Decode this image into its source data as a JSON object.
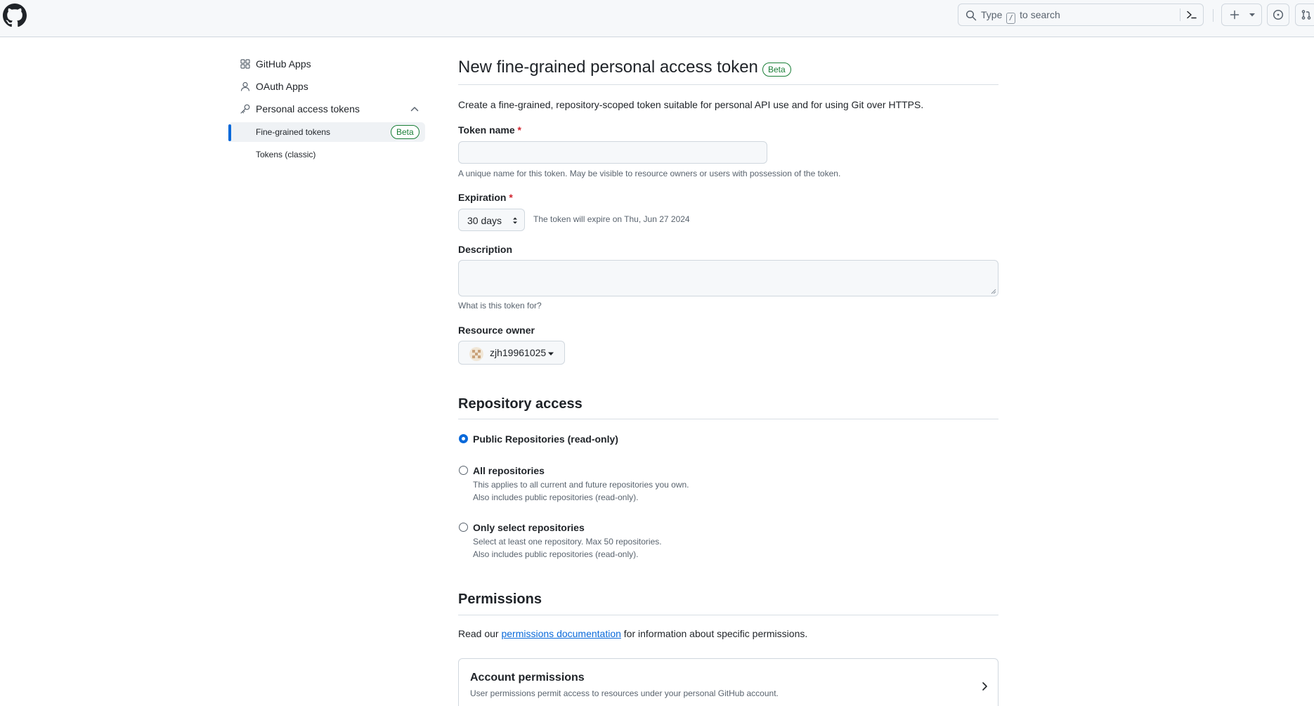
{
  "search": {
    "prefix": "Type",
    "key": "/",
    "suffix": "to search"
  },
  "sidebar": {
    "items": [
      {
        "label": "GitHub Apps"
      },
      {
        "label": "OAuth Apps"
      },
      {
        "label": "Personal access tokens"
      }
    ],
    "sub_items": [
      {
        "label": "Fine-grained tokens",
        "badge": "Beta",
        "active": true
      },
      {
        "label": "Tokens (classic)"
      }
    ]
  },
  "main": {
    "title": "New fine-grained personal access token",
    "title_badge": "Beta",
    "lead": "Create a fine-grained, repository-scoped token suitable for personal API use and for using Git over HTTPS.",
    "token_name": {
      "label": "Token name",
      "required_mark": "*",
      "value": "",
      "note": "A unique name for this token. May be visible to resource owners or users with possession of the token."
    },
    "expiration": {
      "label": "Expiration",
      "required_mark": "*",
      "value": "30 days",
      "note": "The token will expire on Thu, Jun 27 2024"
    },
    "description": {
      "label": "Description",
      "value": "",
      "note": "What is this token for?"
    },
    "resource_owner": {
      "label": "Resource owner",
      "value": "zjh19961025"
    },
    "repository_access": {
      "heading": "Repository access",
      "options": [
        {
          "label": "Public Repositories (read-only)",
          "checked": true,
          "desc": []
        },
        {
          "label": "All repositories",
          "checked": false,
          "desc": [
            "This applies to all current and future repositories you own.",
            "Also includes public repositories (read-only)."
          ]
        },
        {
          "label": "Only select repositories",
          "checked": false,
          "desc": [
            "Select at least one repository. Max 50 repositories.",
            "Also includes public repositories (read-only)."
          ]
        }
      ]
    },
    "permissions": {
      "heading": "Permissions",
      "text_before": "Read our",
      "link": "permissions documentation",
      "text_after": "for information about specific permissions.",
      "account": {
        "title": "Account permissions",
        "desc": "User permissions permit access to resources under your personal GitHub account."
      }
    }
  },
  "colors": {
    "accent": "#0969da",
    "success": "#1a7f37",
    "danger": "#d1242f",
    "header_bg": "#f6f8fa",
    "border": "#d0d7de"
  }
}
